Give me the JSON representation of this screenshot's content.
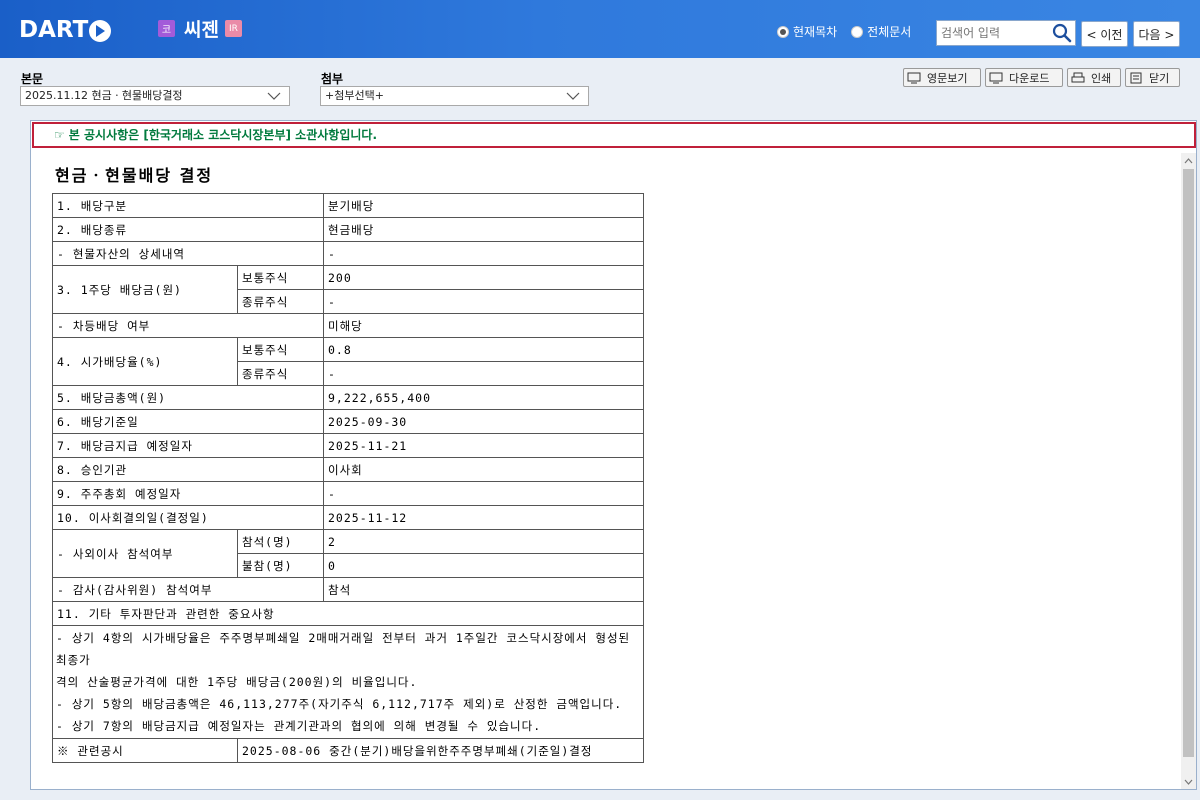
{
  "header": {
    "logo_text": "DART",
    "market_badge": "코",
    "company_name": "씨젠",
    "ir_badge": "IR",
    "radio_current": "현재목차",
    "radio_all": "전체문서",
    "search_placeholder": "검색어 입력",
    "prev_label": "< 이전",
    "next_label": "다음 >"
  },
  "toolbar": {
    "main_label": "본문",
    "main_select": "2025.11.12  현금ㆍ현물배당결정",
    "attach_label": "첨부",
    "attach_select": "+첨부선택+",
    "english_label": "영문보기",
    "download_label": "다운로드",
    "print_label": "인쇄",
    "close_label": "닫기"
  },
  "notice": {
    "text": "본 공시사항은 [한국거래소 코스닥시장본부] 소관사항입니다."
  },
  "document": {
    "title": "현금ㆍ현물배당 결정",
    "rows": {
      "r1_label": "1. 배당구분",
      "r1_value": "분기배당",
      "r2_label": "2. 배당종류",
      "r2_value": "현금배당",
      "r3_label": "- 현물자산의 상세내역",
      "r3_value": "-",
      "r4_label": "3. 1주당 배당금(원)",
      "r4a_sub": "보통주식",
      "r4a_value": "200",
      "r4b_sub": "종류주식",
      "r4b_value": "-",
      "r5_label": "- 차등배당 여부",
      "r5_value": "미해당",
      "r6_label": "4. 시가배당율(%)",
      "r6a_sub": "보통주식",
      "r6a_value": "0.8",
      "r6b_sub": "종류주식",
      "r6b_value": "-",
      "r7_label": "5. 배당금총액(원)",
      "r7_value": "9,222,655,400",
      "r8_label": "6. 배당기준일",
      "r8_value": "2025-09-30",
      "r9_label": "7. 배당금지급 예정일자",
      "r9_value": "2025-11-21",
      "r10_label": "8. 승인기관",
      "r10_value": "이사회",
      "r11_label": "9. 주주총회 예정일자",
      "r11_value": "-",
      "r12_label": "10. 이사회결의일(결정일)",
      "r12_value": "2025-11-12",
      "r13_label": "- 사외이사 참석여부",
      "r13a_sub": "참석(명)",
      "r13a_value": "2",
      "r13b_sub": "불참(명)",
      "r13b_value": "0",
      "r14_label": "- 감사(감사위원) 참석여부",
      "r14_value": "참석",
      "r15_label": "11. 기타 투자판단과 관련한 중요사항",
      "note_line1": "- 상기 4항의 시가배당율은 주주명부폐쇄일 2매매거래일 전부터 과거 1주일간 코스닥시장에서 형성된 최종가",
      "note_line2": "격의 산술평균가격에 대한 1주당 배당금(200원)의 비율입니다.",
      "note_line3": "- 상기 5항의 배당금총액은 46,113,277주(자기주식 6,112,717주 제외)로 산정한 금액입니다.",
      "note_line4": "- 상기 7항의 배당금지급 예정일자는 관계기관과의 협의에 의해 변경될 수 있습니다.",
      "r16_label": "※ 관련공시",
      "r16_value": "2025-08-06 중간(분기)배당을위한주주명부폐쇄(기준일)결정"
    }
  }
}
